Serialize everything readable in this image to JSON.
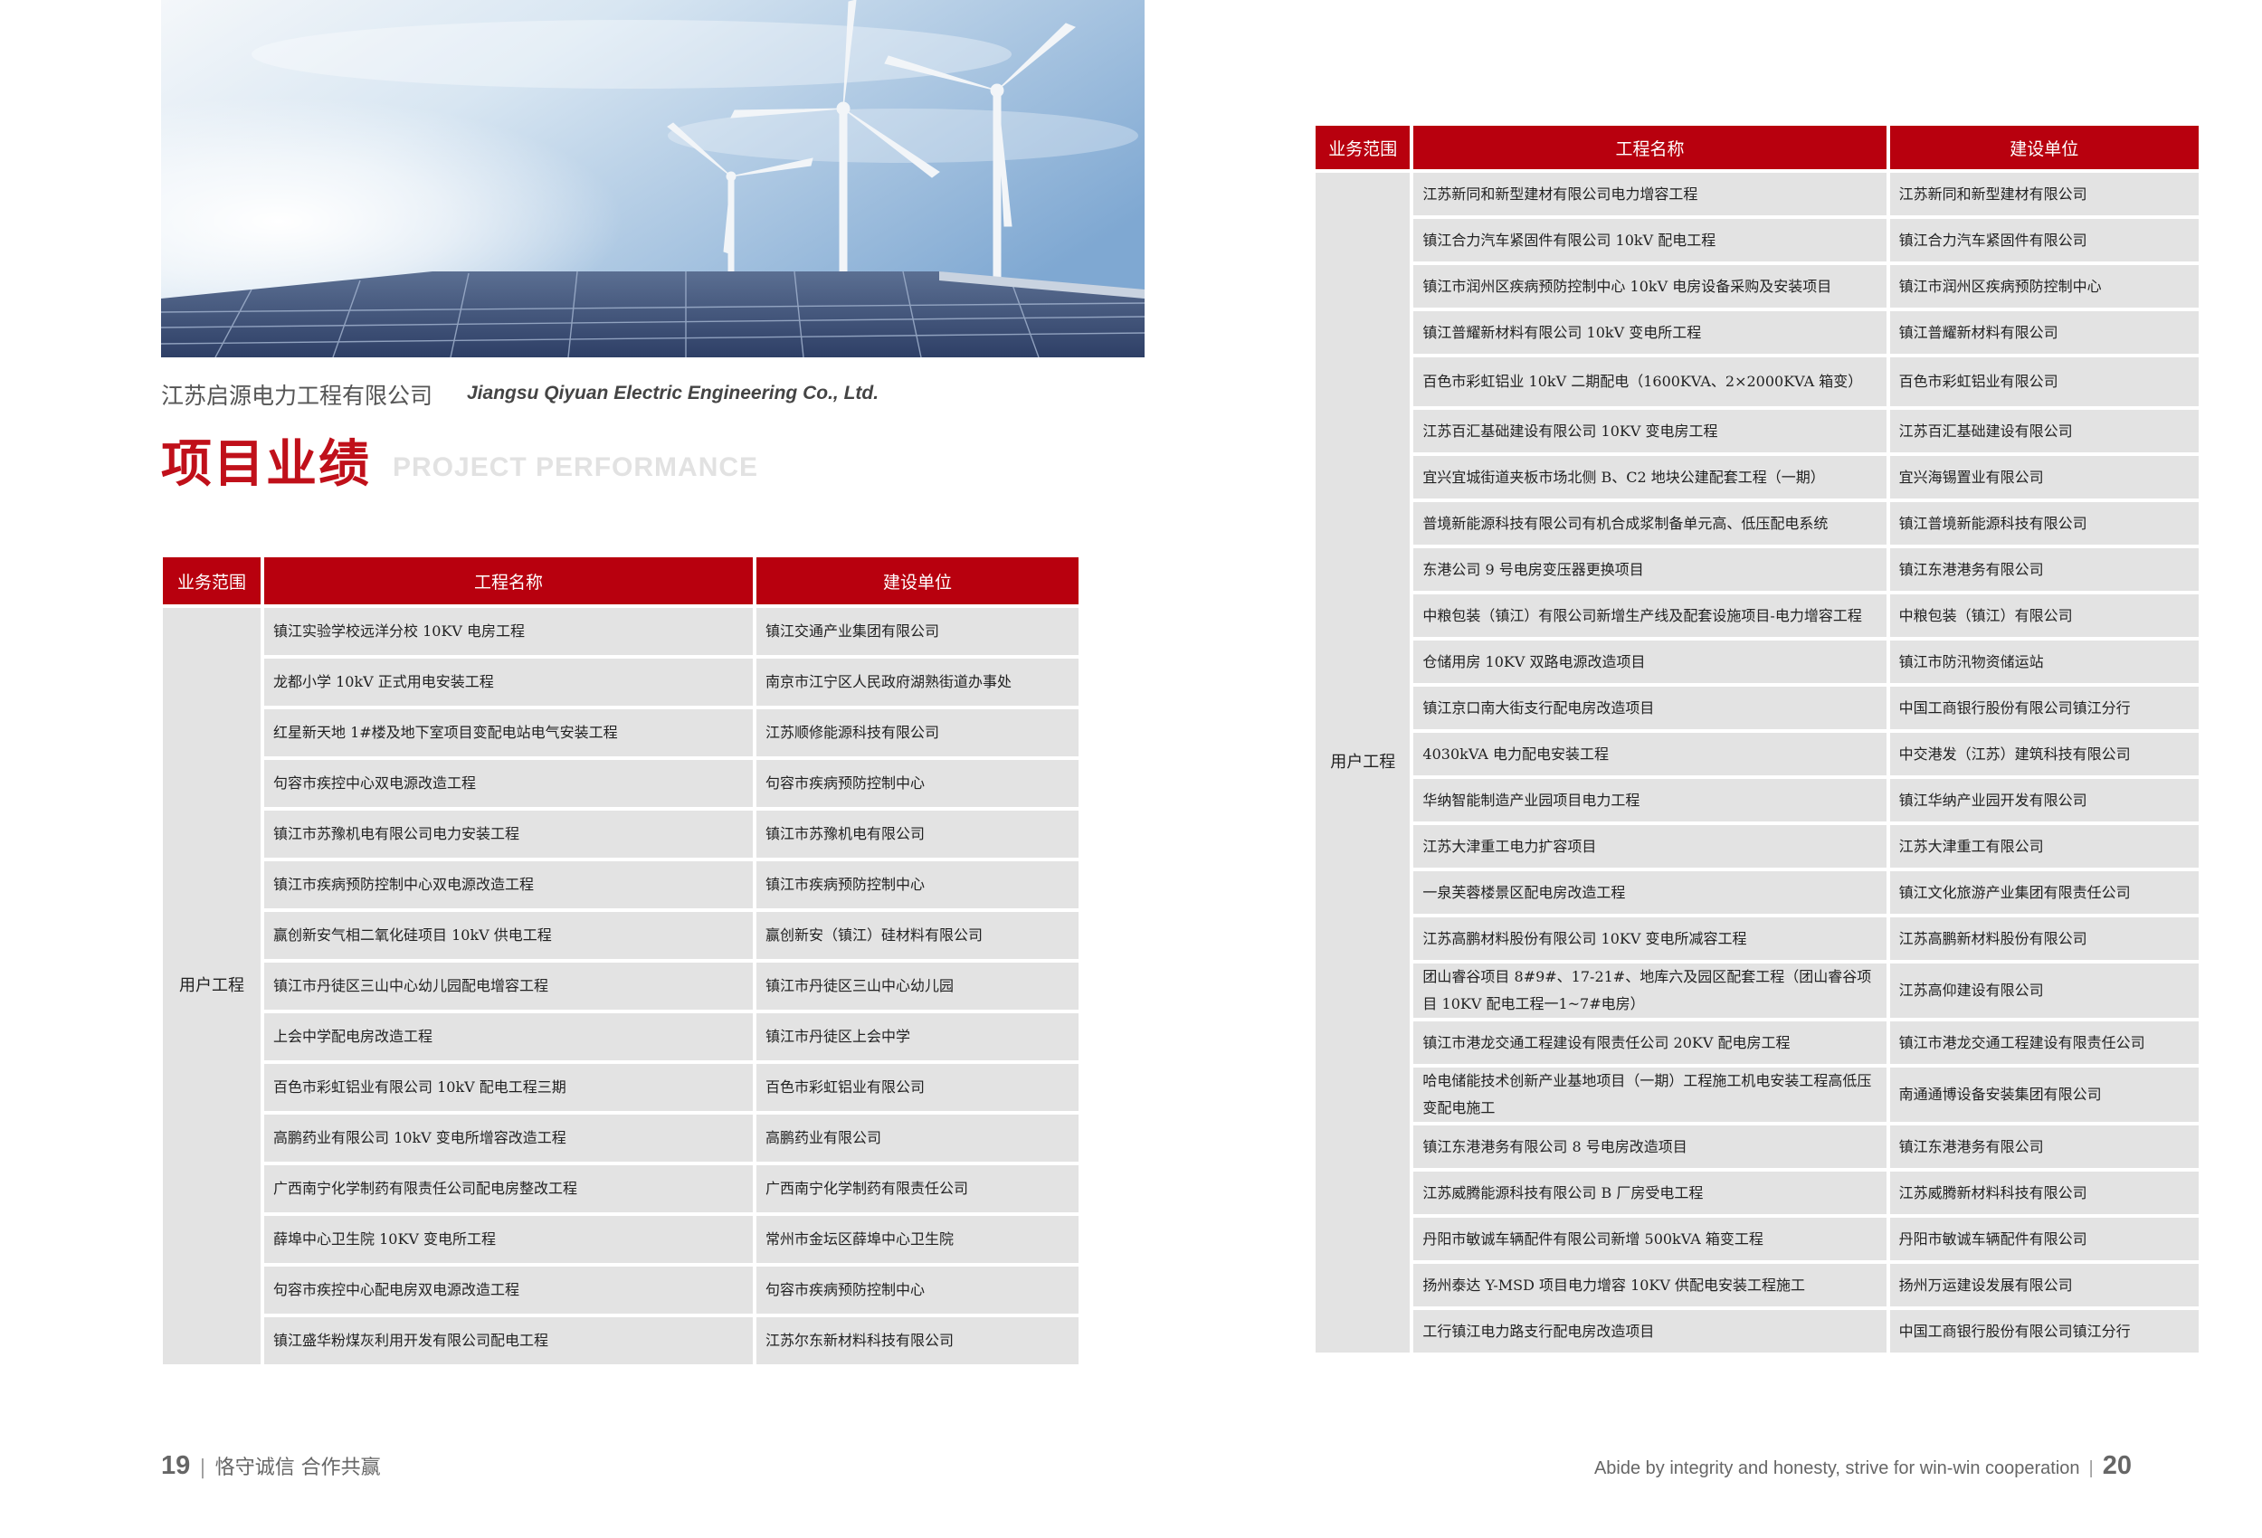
{
  "header": {
    "company_cn": "江苏启源电力工程有限公司",
    "company_en": "Jiangsu Qiyuan Electric Engineering Co., Ltd.",
    "section_cn": "项目业绩",
    "section_en": "PROJECT PERFORMANCE"
  },
  "table_headers": {
    "scope": "业务范围",
    "project": "工程名称",
    "client": "建设单位"
  },
  "left_table": {
    "category": "用户工程",
    "rows": [
      {
        "project": "镇江实验学校远洋分校 10KV 电房工程",
        "client": "镇江交通产业集团有限公司"
      },
      {
        "project": "龙都小学 10kV 正式用电安装工程",
        "client": "南京市江宁区人民政府湖熟街道办事处"
      },
      {
        "project": "红星新天地 1#楼及地下室项目变配电站电气安装工程",
        "client": "江苏顺修能源科技有限公司"
      },
      {
        "project": "句容市疾控中心双电源改造工程",
        "client": "句容市疾病预防控制中心"
      },
      {
        "project": "镇江市苏豫机电有限公司电力安装工程",
        "client": "镇江市苏豫机电有限公司"
      },
      {
        "project": "镇江市疾病预防控制中心双电源改造工程",
        "client": "镇江市疾病预防控制中心"
      },
      {
        "project": "赢创新安气相二氧化硅项目 10kV 供电工程",
        "client": "赢创新安（镇江）硅材料有限公司"
      },
      {
        "project": "镇江市丹徒区三山中心幼儿园配电增容工程",
        "client": "镇江市丹徒区三山中心幼儿园"
      },
      {
        "project": "上会中学配电房改造工程",
        "client": "镇江市丹徒区上会中学"
      },
      {
        "project": "百色市彩虹铝业有限公司 10kV 配电工程三期",
        "client": "百色市彩虹铝业有限公司"
      },
      {
        "project": "高鹏药业有限公司 10kV 变电所增容改造工程",
        "client": "高鹏药业有限公司"
      },
      {
        "project": "广西南宁化学制药有限责任公司配电房整改工程",
        "client": "广西南宁化学制药有限责任公司"
      },
      {
        "project": "薛埠中心卫生院 10KV 变电所工程",
        "client": "常州市金坛区薛埠中心卫生院"
      },
      {
        "project": "句容市疾控中心配电房双电源改造工程",
        "client": "句容市疾病预防控制中心"
      },
      {
        "project": "镇江盛华粉煤灰利用开发有限公司配电工程",
        "client": "江苏尔东新材料科技有限公司"
      }
    ]
  },
  "right_table": {
    "category": "用户工程",
    "rows": [
      {
        "project": "江苏新同和新型建材有限公司电力增容工程",
        "client": "江苏新同和新型建材有限公司"
      },
      {
        "project": "镇江合力汽车紧固件有限公司 10kV 配电工程",
        "client": "镇江合力汽车紧固件有限公司"
      },
      {
        "project": "镇江市润州区疾病预防控制中心 10kV 电房设备采购及安装项目",
        "client": "镇江市润州区疾病预防控制中心"
      },
      {
        "project": "镇江普耀新材料有限公司 10kV 变电所工程",
        "client": "镇江普耀新材料有限公司"
      },
      {
        "project": "百色市彩虹铝业 10kV 二期配电（1600KVA、2×2000KVA 箱变）",
        "client": "百色市彩虹铝业有限公司"
      },
      {
        "project": "江苏百汇基础建设有限公司 10KV 变电房工程",
        "client": "江苏百汇基础建设有限公司"
      },
      {
        "project": "宜兴宜城街道夹板市场北侧 B、C2 地块公建配套工程（一期）",
        "client": "宜兴海锡置业有限公司"
      },
      {
        "project": "普境新能源科技有限公司有机合成浆制备单元高、低压配电系统",
        "client": "镇江普境新能源科技有限公司"
      },
      {
        "project": "东港公司 9 号电房变压器更换项目",
        "client": "镇江东港港务有限公司"
      },
      {
        "project": "中粮包装（镇江）有限公司新增生产线及配套设施项目-电力增容工程",
        "client": "中粮包装（镇江）有限公司"
      },
      {
        "project": "仓储用房 10KV 双路电源改造项目",
        "client": "镇江市防汛物资储运站"
      },
      {
        "project": "镇江京口南大街支行配电房改造项目",
        "client": "中国工商银行股份有限公司镇江分行"
      },
      {
        "project": "4030kVA 电力配电安装工程",
        "client": "中交港发（江苏）建筑科技有限公司"
      },
      {
        "project": "华纳智能制造产业园项目电力工程",
        "client": "镇江华纳产业园开发有限公司"
      },
      {
        "project": "江苏大津重工电力扩容项目",
        "client": "江苏大津重工有限公司"
      },
      {
        "project": "一泉芙蓉楼景区配电房改造工程",
        "client": "镇江文化旅游产业集团有限责任公司"
      },
      {
        "project": "江苏高鹏材料股份有限公司 10KV 变电所减容工程",
        "client": "江苏高鹏新材料股份有限公司"
      },
      {
        "project": "团山睿谷项目 8#9#、17-21#、地库六及园区配套工程（团山睿谷项目 10KV 配电工程一1~7#电房）",
        "client": "江苏高仰建设有限公司"
      },
      {
        "project": "镇江市港龙交通工程建设有限责任公司 20KV 配电房工程",
        "client": "镇江市港龙交通工程建设有限责任公司"
      },
      {
        "project": "哈电储能技术创新产业基地项目（一期）工程施工机电安装工程高低压变配电施工",
        "client": "南通通博设备安装集团有限公司"
      },
      {
        "project": "镇江东港港务有限公司 8 号电房改造项目",
        "client": "镇江东港港务有限公司"
      },
      {
        "project": "江苏威腾能源科技有限公司 B 厂房受电工程",
        "client": "江苏威腾新材料科技有限公司"
      },
      {
        "project": "丹阳市敏诚车辆配件有限公司新增 500kVA 箱变工程",
        "client": "丹阳市敏诚车辆配件有限公司"
      },
      {
        "project": "扬州泰达 Y-MSD 项目电力增容 10KV 供配电安装工程施工",
        "client": "扬州万运建设发展有限公司"
      },
      {
        "project": "工行镇江电力路支行配电房改造项目",
        "client": "中国工商银行股份有限公司镇江分行"
      }
    ]
  },
  "footer": {
    "left_page": "19",
    "left_slogan": "恪守诚信 合作共赢",
    "right_slogan": "Abide by integrity and honesty, strive for win-win cooperation",
    "right_page": "20"
  }
}
